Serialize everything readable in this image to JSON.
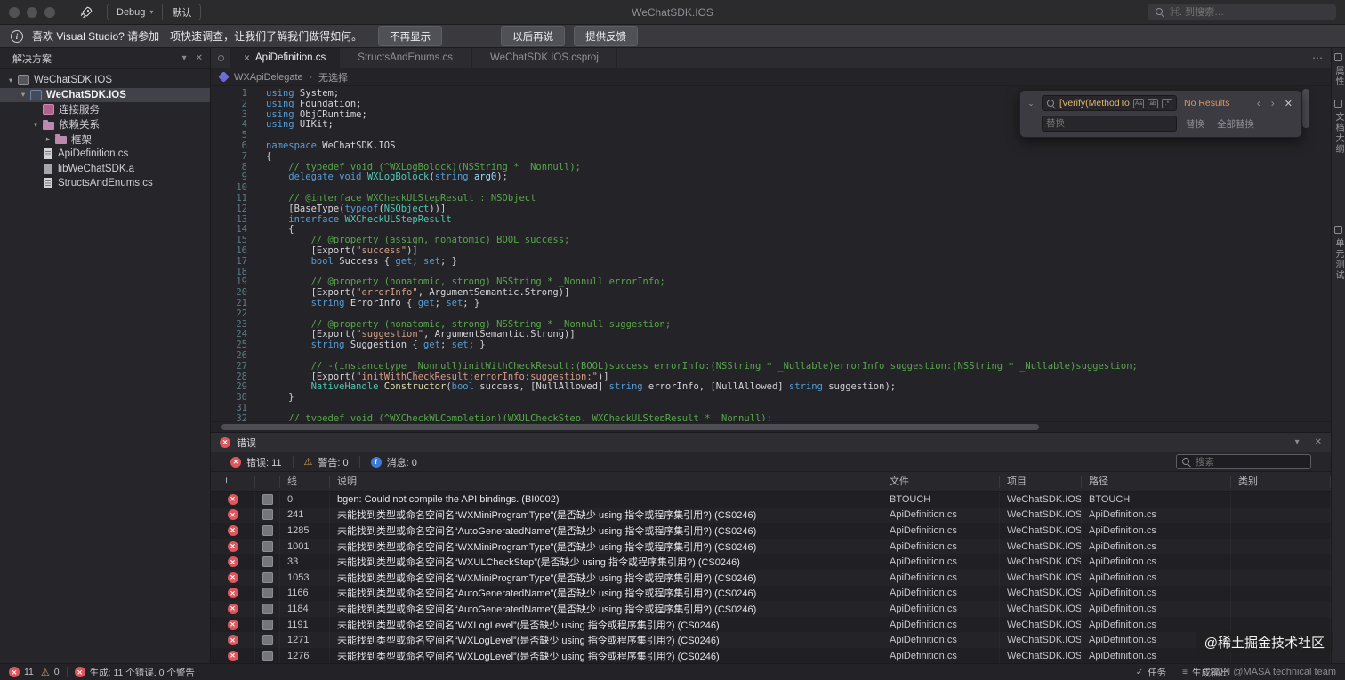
{
  "icons": {
    "error_glyph": "✕",
    "warning_glyph": "⚠",
    "check_glyph": "✓",
    "list_glyph": "≡",
    "info_glyph": "i",
    "chevron_down": "▾",
    "chevron_right": "▸",
    "collapse_chevron": "⌄",
    "close_glyph": "✕",
    "ellipsis_glyph": "⋯",
    "prev_glyph": "‹",
    "next_glyph": "›",
    "breadcrumb_sep": "›",
    "pad_menu_glyph": "▾"
  },
  "titlebar": {
    "title": "WeChatSDK.IOS",
    "debug_label": "Debug",
    "config_label": "默认",
    "search_placeholder": "⌘. 到搜索…"
  },
  "notification": {
    "text": "喜欢 Visual Studio? 请参加一项快速调查，让我们了解我们做得如何。",
    "buttons": [
      "不再显示",
      "以后再说",
      "提供反馈"
    ]
  },
  "sidebar": {
    "title": "解决方案",
    "tree": [
      {
        "label": "WeChatSDK.IOS",
        "depth": 0,
        "icon": "solution",
        "expanded": true
      },
      {
        "label": "WeChatSDK.IOS",
        "depth": 1,
        "icon": "project",
        "expanded": true,
        "selected": true,
        "bold": true
      },
      {
        "label": "连接服务",
        "depth": 2,
        "icon": "services"
      },
      {
        "label": "依赖关系",
        "depth": 2,
        "icon": "folder",
        "expanded": true
      },
      {
        "label": "框架",
        "depth": 3,
        "icon": "folder",
        "expanded": false
      },
      {
        "label": "ApiDefinition.cs",
        "depth": 2,
        "icon": "file-cs"
      },
      {
        "label": "libWeChatSDK.a",
        "depth": 2,
        "icon": "file-lib"
      },
      {
        "label": "StructsAndEnums.cs",
        "depth": 2,
        "icon": "file-cs"
      }
    ]
  },
  "tabs": [
    {
      "label": "ApiDefinition.cs",
      "active": true
    },
    {
      "label": "StructsAndEnums.cs",
      "active": false
    },
    {
      "label": "WeChatSDK.IOS.csproj",
      "active": false
    }
  ],
  "breadcrumb": {
    "scope": "WXApiDelegate",
    "selection": "无选择"
  },
  "find": {
    "query": "[Verify(MethodToProp",
    "options": [
      "Aa",
      "ab",
      ".*"
    ],
    "result": "No Results",
    "replace_placeholder": "替换",
    "replace_button": "替换",
    "replace_all_button": "全部替换"
  },
  "editor": {
    "lines": [
      [
        [
          "k",
          "using"
        ],
        [
          "p",
          " System;"
        ]
      ],
      [
        [
          "k",
          "using"
        ],
        [
          "p",
          " Foundation;"
        ]
      ],
      [
        [
          "k",
          "using"
        ],
        [
          "p",
          " ObjCRuntime;"
        ]
      ],
      [
        [
          "k",
          "using"
        ],
        [
          "p",
          " UIKit;"
        ]
      ],
      [],
      [
        [
          "k",
          "namespace"
        ],
        [
          "p",
          " WeChatSDK.IOS"
        ]
      ],
      [
        [
          "p",
          "{"
        ]
      ],
      [
        [
          "c",
          "    // typedef void (^WXLogBolock)(NSString * _Nonnull);"
        ]
      ],
      [
        [
          "p",
          "    "
        ],
        [
          "k",
          "delegate"
        ],
        [
          "p",
          " "
        ],
        [
          "k",
          "void"
        ],
        [
          "p",
          " "
        ],
        [
          "t",
          "WXLogBolock"
        ],
        [
          "p",
          "("
        ],
        [
          "k",
          "string"
        ],
        [
          "p",
          " "
        ],
        [
          "a",
          "arg0"
        ],
        [
          "p",
          ");"
        ]
      ],
      [],
      [
        [
          "c",
          "    // @interface WXCheckULStepResult : NSObject"
        ]
      ],
      [
        [
          "p",
          "    [BaseType("
        ],
        [
          "k",
          "typeof"
        ],
        [
          "p",
          "("
        ],
        [
          "t",
          "NSObject"
        ],
        [
          "p",
          "))]"
        ]
      ],
      [
        [
          "p",
          "    "
        ],
        [
          "k",
          "interface"
        ],
        [
          "p",
          " "
        ],
        [
          "t",
          "WXCheckULStepResult"
        ]
      ],
      [
        [
          "p",
          "    {"
        ]
      ],
      [
        [
          "c",
          "        // @property (assign, nonatomic) BOOL success;"
        ]
      ],
      [
        [
          "p",
          "        [Export("
        ],
        [
          "s",
          "\"success\""
        ],
        [
          "p",
          ")]"
        ]
      ],
      [
        [
          "p",
          "        "
        ],
        [
          "k",
          "bool"
        ],
        [
          "p",
          " Success { "
        ],
        [
          "k",
          "get"
        ],
        [
          "p",
          "; "
        ],
        [
          "k",
          "set"
        ],
        [
          "p",
          "; }"
        ]
      ],
      [],
      [
        [
          "c",
          "        // @property (nonatomic, strong) NSString * _Nonnull errorInfo;"
        ]
      ],
      [
        [
          "p",
          "        [Export("
        ],
        [
          "s",
          "\"errorInfo\""
        ],
        [
          "p",
          ", ArgumentSemantic.Strong)]"
        ]
      ],
      [
        [
          "p",
          "        "
        ],
        [
          "k",
          "string"
        ],
        [
          "p",
          " ErrorInfo { "
        ],
        [
          "k",
          "get"
        ],
        [
          "p",
          "; "
        ],
        [
          "k",
          "set"
        ],
        [
          "p",
          "; }"
        ]
      ],
      [],
      [
        [
          "c",
          "        // @property (nonatomic, strong) NSString * _Nonnull suggestion;"
        ]
      ],
      [
        [
          "p",
          "        [Export("
        ],
        [
          "s",
          "\"suggestion\""
        ],
        [
          "p",
          ", ArgumentSemantic.Strong)]"
        ]
      ],
      [
        [
          "p",
          "        "
        ],
        [
          "k",
          "string"
        ],
        [
          "p",
          " Suggestion { "
        ],
        [
          "k",
          "get"
        ],
        [
          "p",
          "; "
        ],
        [
          "k",
          "set"
        ],
        [
          "p",
          "; }"
        ]
      ],
      [],
      [
        [
          "c",
          "        // -(instancetype _Nonnull)initWithCheckResult:(BOOL)success errorInfo:(NSString * _Nullable)errorInfo suggestion:(NSString * _Nullable)suggestion;"
        ]
      ],
      [
        [
          "p",
          "        [Export("
        ],
        [
          "s",
          "\"initWithCheckResult:errorInfo:suggestion:\""
        ],
        [
          "p",
          ")]"
        ]
      ],
      [
        [
          "p",
          "        "
        ],
        [
          "t",
          "NativeHandle"
        ],
        [
          "p",
          " "
        ],
        [
          "m",
          "Constructor"
        ],
        [
          "p",
          "("
        ],
        [
          "k",
          "bool"
        ],
        [
          "p",
          " success, [NullAllowed] "
        ],
        [
          "k",
          "string"
        ],
        [
          "p",
          " errorInfo, [NullAllowed] "
        ],
        [
          "k",
          "string"
        ],
        [
          "p",
          " suggestion);"
        ]
      ],
      [
        [
          "p",
          "    }"
        ]
      ],
      [],
      [
        [
          "c",
          "    // typedef void (^WXCheckWLCompletion)(WXULCheckStep, WXCheckULStepResult * _Nonnull);"
        ]
      ]
    ]
  },
  "error_panel": {
    "title": "错误",
    "filters": [
      {
        "label": "错误: 11",
        "type": "error"
      },
      {
        "label": "警告: 0",
        "type": "warning"
      },
      {
        "label": "消息: 0",
        "type": "info"
      }
    ],
    "search_placeholder": "搜索",
    "columns": [
      "!",
      "",
      "线",
      "说明",
      "文件",
      "项目",
      "路径",
      "类别"
    ],
    "rows": [
      {
        "line": "0",
        "desc": "bgen: Could not compile the API bindings. (BI0002)",
        "file": "BTOUCH",
        "project": "WeChatSDK.IOS",
        "path": "BTOUCH",
        "category": ""
      },
      {
        "line": "241",
        "desc": "未能找到类型或命名空间名“WXMiniProgramType”(是否缺少 using 指令或程序集引用?) (CS0246)",
        "file": "ApiDefinition.cs",
        "project": "WeChatSDK.IOS",
        "path": "ApiDefinition.cs",
        "category": ""
      },
      {
        "line": "1285",
        "desc": "未能找到类型或命名空间名“AutoGeneratedName”(是否缺少 using 指令或程序集引用?) (CS0246)",
        "file": "ApiDefinition.cs",
        "project": "WeChatSDK.IOS",
        "path": "ApiDefinition.cs",
        "category": ""
      },
      {
        "line": "1001",
        "desc": "未能找到类型或命名空间名“WXMiniProgramType”(是否缺少 using 指令或程序集引用?) (CS0246)",
        "file": "ApiDefinition.cs",
        "project": "WeChatSDK.IOS",
        "path": "ApiDefinition.cs",
        "category": ""
      },
      {
        "line": "33",
        "desc": "未能找到类型或命名空间名“WXULCheckStep”(是否缺少 using 指令或程序集引用?) (CS0246)",
        "file": "ApiDefinition.cs",
        "project": "WeChatSDK.IOS",
        "path": "ApiDefinition.cs",
        "category": ""
      },
      {
        "line": "1053",
        "desc": "未能找到类型或命名空间名“WXMiniProgramType”(是否缺少 using 指令或程序集引用?) (CS0246)",
        "file": "ApiDefinition.cs",
        "project": "WeChatSDK.IOS",
        "path": "ApiDefinition.cs",
        "category": ""
      },
      {
        "line": "1166",
        "desc": "未能找到类型或命名空间名“AutoGeneratedName”(是否缺少 using 指令或程序集引用?) (CS0246)",
        "file": "ApiDefinition.cs",
        "project": "WeChatSDK.IOS",
        "path": "ApiDefinition.cs",
        "category": ""
      },
      {
        "line": "1184",
        "desc": "未能找到类型或命名空间名“AutoGeneratedName”(是否缺少 using 指令或程序集引用?) (CS0246)",
        "file": "ApiDefinition.cs",
        "project": "WeChatSDK.IOS",
        "path": "ApiDefinition.cs",
        "category": ""
      },
      {
        "line": "1191",
        "desc": "未能找到类型或命名空间名“WXLogLevel”(是否缺少 using 指令或程序集引用?) (CS0246)",
        "file": "ApiDefinition.cs",
        "project": "WeChatSDK.IOS",
        "path": "ApiDefinition.cs",
        "category": ""
      },
      {
        "line": "1271",
        "desc": "未能找到类型或命名空间名“WXLogLevel”(是否缺少 using 指令或程序集引用?) (CS0246)",
        "file": "ApiDefinition.cs",
        "project": "WeChatSDK.IOS",
        "path": "ApiDefinition.cs",
        "category": ""
      },
      {
        "line": "1276",
        "desc": "未能找到类型或命名空间名“WXLogLevel”(是否缺少 using 指令或程序集引用?) (CS0246)",
        "file": "ApiDefinition.cs",
        "project": "WeChatSDK.IOS",
        "path": "ApiDefinition.cs",
        "category": ""
      }
    ]
  },
  "statusbar": {
    "error_count": "11",
    "warning_count": "0",
    "build_message": "生成: 11 个错误, 0 个警告",
    "tasks_label": "任务",
    "build_output_label": "生成输出"
  },
  "right_rail": {
    "tabs": [
      {
        "label": "属性"
      },
      {
        "label": "文档大纲"
      },
      {
        "label": "单元测试"
      }
    ]
  },
  "watermarks": {
    "primary": "@稀土掘金技术社区",
    "secondary": "CSDN @MASA technical team"
  }
}
